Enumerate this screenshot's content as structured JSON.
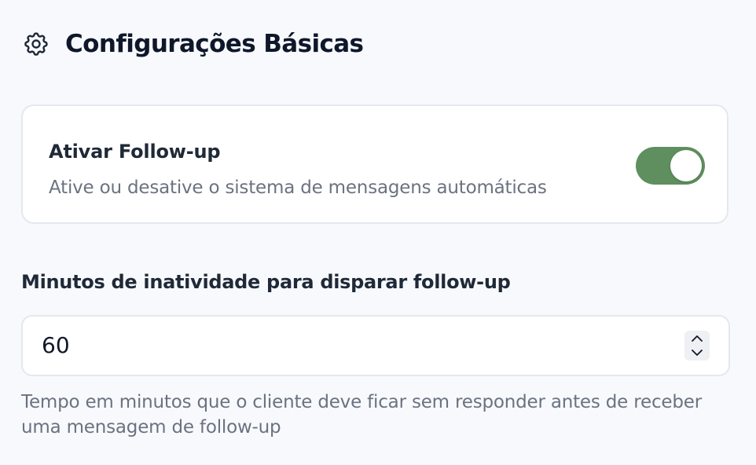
{
  "section": {
    "title": "Configurações Básicas",
    "icon": "gear-icon"
  },
  "followup_toggle": {
    "label": "Ativar Follow-up",
    "description": "Ative ou desative o sistema de mensagens automáticas",
    "enabled": true,
    "on_color": "#5f8f5f"
  },
  "inactivity_field": {
    "label": "Minutos de inatividade para disparar follow-up",
    "value": "60",
    "help_text": "Tempo em minutos que o cliente deve ficar sem responder antes de receber uma mensagem de follow-up"
  }
}
